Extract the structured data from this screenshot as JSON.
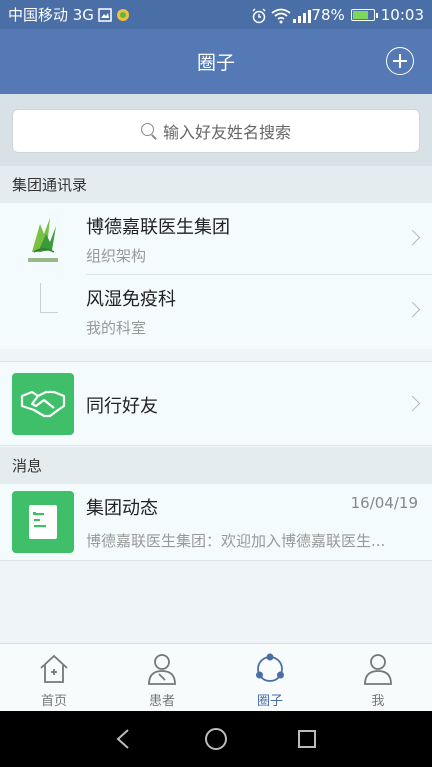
{
  "status_bar": {
    "carrier": "中国移动 3G",
    "battery": "78%",
    "time": "10:03",
    "battery_level": 0.78
  },
  "header": {
    "title": "圈子"
  },
  "search": {
    "placeholder": "输入好友姓名搜索"
  },
  "sections": {
    "directory": "集团通讯录",
    "messages": "消息"
  },
  "directory_items": [
    {
      "title": "博德嘉联医生集团",
      "subtitle": "组织架构"
    },
    {
      "title": "风湿免疫科",
      "subtitle": "我的科室"
    }
  ],
  "peers": {
    "title": "同行好友"
  },
  "messages": [
    {
      "title": "集团动态",
      "date": "16/04/19",
      "preview": "博德嘉联医生集团：欢迎加入博德嘉联医生..."
    }
  ],
  "tabs": [
    {
      "label": "首页",
      "icon": "home-icon"
    },
    {
      "label": "患者",
      "icon": "patient-icon"
    },
    {
      "label": "圈子",
      "icon": "circle-icon"
    },
    {
      "label": "我",
      "icon": "me-icon"
    }
  ],
  "colors": {
    "header": "#5479b5",
    "accent": "#4a6ea6",
    "green": "#3fbf6a"
  }
}
